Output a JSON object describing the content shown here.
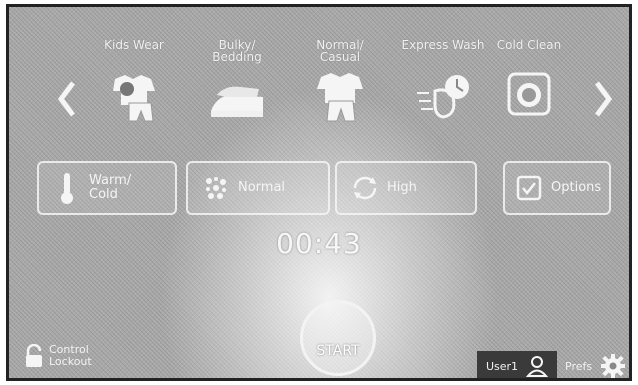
{
  "cycles": [
    {
      "label": "Kids Wear",
      "icon": "kids-clothes-icon"
    },
    {
      "label": "Bulky/\nBedding",
      "icon": "bedding-icon"
    },
    {
      "label": "Normal/\nCasual",
      "icon": "shirt-pants-icon"
    },
    {
      "label": "Express Wash",
      "icon": "express-wash-icon"
    },
    {
      "label": "Cold Clean",
      "icon": "cold-clean-icon"
    }
  ],
  "settings": {
    "temp": "Warm/\nCold",
    "soil": "Normal",
    "spin": "High",
    "options": "Options"
  },
  "timer": "00:43",
  "start_label": "START",
  "control_lockout": "Control\nLockout",
  "user": "User1",
  "prefs": "Prefs",
  "icons": {
    "prev": "chevron-left-icon",
    "next": "chevron-right-icon",
    "temp": "thermometer-icon",
    "soil": "soil-icon",
    "spin": "spin-icon",
    "options": "checkbox-icon",
    "lock": "lock-icon",
    "user": "user-icon",
    "prefs": "gear-icon"
  },
  "colors": {
    "screen": "#a9a9a9",
    "line": "#f5f5f5",
    "user_bar": "#3a3a3a"
  }
}
